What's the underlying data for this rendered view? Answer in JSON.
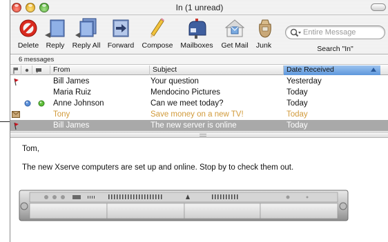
{
  "window": {
    "title": "In (1 unread)"
  },
  "toolbar": {
    "buttons": [
      {
        "id": "delete",
        "label": "Delete",
        "icon": "delete-icon"
      },
      {
        "id": "reply",
        "label": "Reply",
        "icon": "reply-icon"
      },
      {
        "id": "reply_all",
        "label": "Reply All",
        "icon": "reply-all-icon"
      },
      {
        "id": "forward",
        "label": "Forward",
        "icon": "forward-icon"
      },
      {
        "id": "compose",
        "label": "Compose",
        "icon": "compose-pencil-icon"
      },
      {
        "id": "mailboxes",
        "label": "Mailboxes",
        "icon": "mailboxes-icon"
      },
      {
        "id": "get_mail",
        "label": "Get Mail",
        "icon": "get-mail-icon"
      },
      {
        "id": "junk",
        "label": "Junk",
        "icon": "junk-bag-icon"
      }
    ],
    "search": {
      "placeholder": "Entire Message",
      "label": "Search \"In\""
    }
  },
  "status": {
    "message_count": "6 messages"
  },
  "columns": {
    "from": "From",
    "subject": "Subject",
    "date": "Date Received",
    "sort_direction": "ascending"
  },
  "messages": [
    {
      "from": "Bill James",
      "subject": "Your question",
      "date": "Yesterday",
      "flag": true,
      "state": "normal"
    },
    {
      "from": "Maria Ruiz",
      "subject": "Mendocino Pictures",
      "date": "Today",
      "flag": false,
      "state": "normal"
    },
    {
      "from": "Anne Johnson",
      "subject": "Can we meet today?",
      "date": "Today",
      "flag": false,
      "state": "unread-buddy"
    },
    {
      "from": "Tony",
      "subject": "Save money on a new TV!",
      "date": "Today",
      "flag": false,
      "state": "junk"
    },
    {
      "from": "Bill James",
      "subject": "The new server is online",
      "date": "Today",
      "flag": true,
      "state": "selected"
    }
  ],
  "preview": {
    "greeting": "Tom,",
    "text": "The new Xserve computers are set up and online. Stop by to check them out."
  },
  "colors": {
    "selected_row": "#a9a9a9",
    "junk_text": "#d19a3a",
    "sorted_header": "#5e97dc",
    "flag": "#c8141e"
  }
}
